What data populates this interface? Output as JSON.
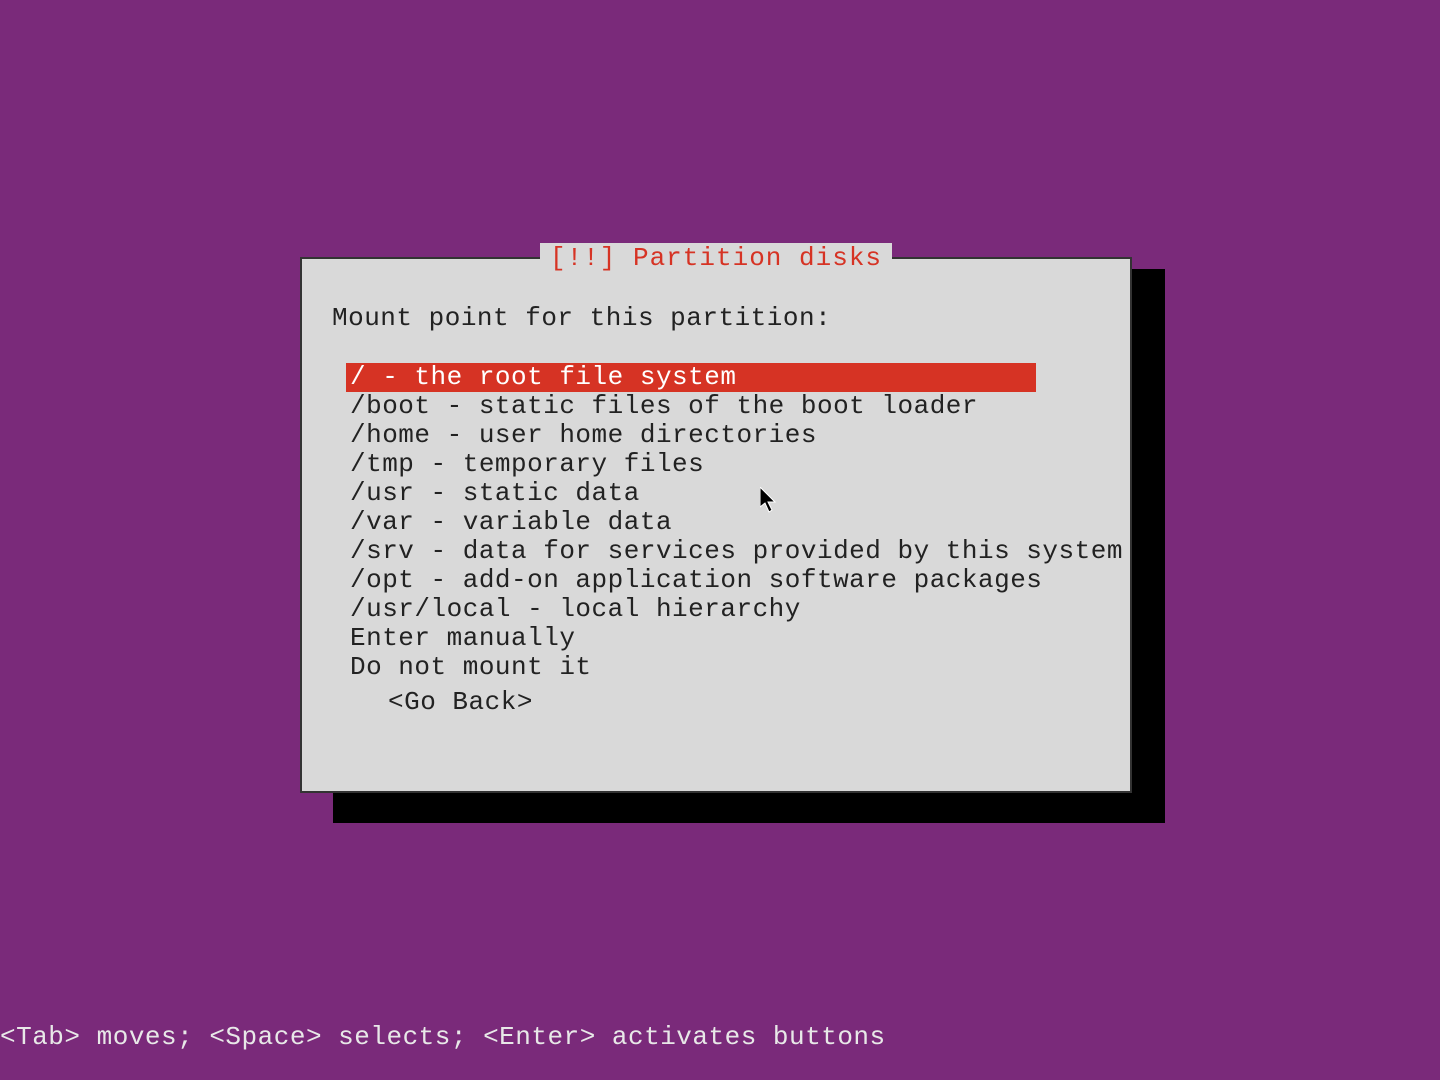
{
  "dialog": {
    "title": "[!!] Partition disks",
    "prompt": "Mount point for this partition:",
    "options": [
      "/ - the root file system",
      "/boot - static files of the boot loader",
      "/home - user home directories",
      "/tmp - temporary files",
      "/usr - static data",
      "/var - variable data",
      "/srv - data for services provided by this system",
      "/opt - add-on application software packages",
      "/usr/local - local hierarchy",
      "Enter manually",
      "Do not mount it"
    ],
    "selected_index": 0,
    "go_back": "<Go Back>"
  },
  "help_bar": "<Tab> moves; <Space> selects; <Enter> activates buttons"
}
